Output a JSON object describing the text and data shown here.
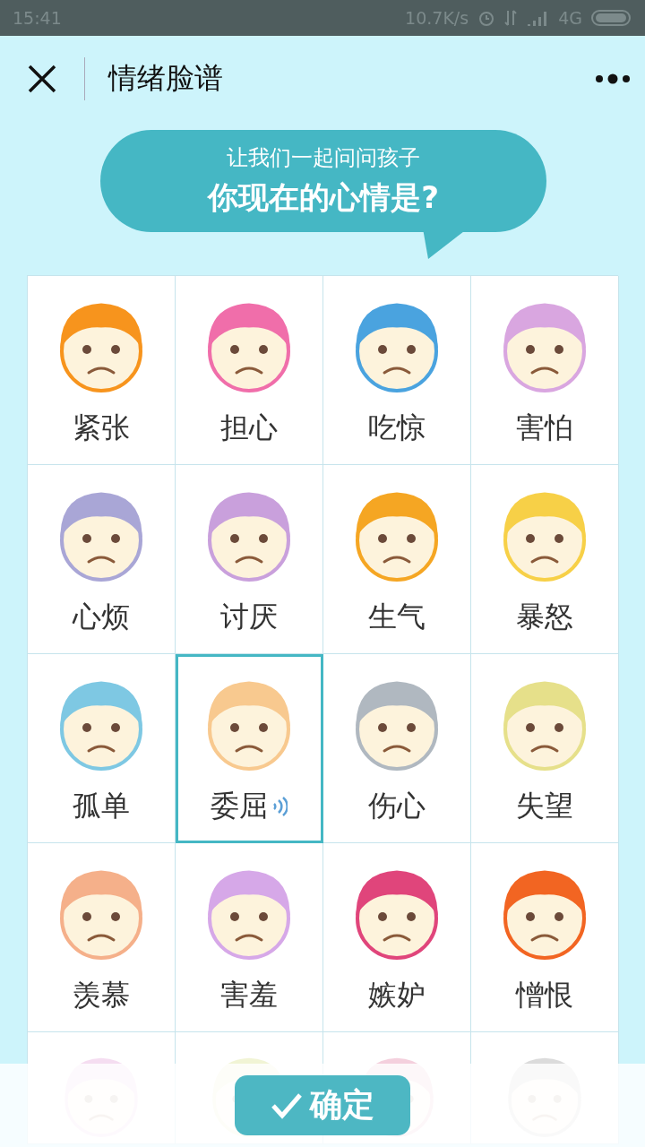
{
  "status_bar": {
    "time": "15:41",
    "speed": "10.7K/s",
    "network": "4G"
  },
  "header": {
    "title": "情绪脸谱"
  },
  "prompt": {
    "line_1": "让我们一起问问孩子",
    "line_2": "你现在的心情是?"
  },
  "emotions": [
    {
      "label": "紧张",
      "selected": false,
      "color": "#f7941d"
    },
    {
      "label": "担心",
      "selected": false,
      "color": "#f06eaa"
    },
    {
      "label": "吃惊",
      "selected": false,
      "color": "#4aa3df"
    },
    {
      "label": "害怕",
      "selected": false,
      "color": "#d9a6e0"
    },
    {
      "label": "心烦",
      "selected": false,
      "color": "#a9a6d6"
    },
    {
      "label": "讨厌",
      "selected": false,
      "color": "#c9a0dc"
    },
    {
      "label": "生气",
      "selected": false,
      "color": "#f5a623"
    },
    {
      "label": "暴怒",
      "selected": false,
      "color": "#f7d047"
    },
    {
      "label": "孤单",
      "selected": false,
      "color": "#7ec8e3"
    },
    {
      "label": "委屈",
      "selected": true,
      "color": "#f8c98f"
    },
    {
      "label": "伤心",
      "selected": false,
      "color": "#b0b8c0"
    },
    {
      "label": "失望",
      "selected": false,
      "color": "#e6e08a"
    },
    {
      "label": "羡慕",
      "selected": false,
      "color": "#f5b08a"
    },
    {
      "label": "害羞",
      "selected": false,
      "color": "#d6a8e8"
    },
    {
      "label": "嫉妒",
      "selected": false,
      "color": "#e0457b"
    },
    {
      "label": "憎恨",
      "selected": false,
      "color": "#f26522"
    }
  ],
  "confirm_button": {
    "label": "确定"
  }
}
